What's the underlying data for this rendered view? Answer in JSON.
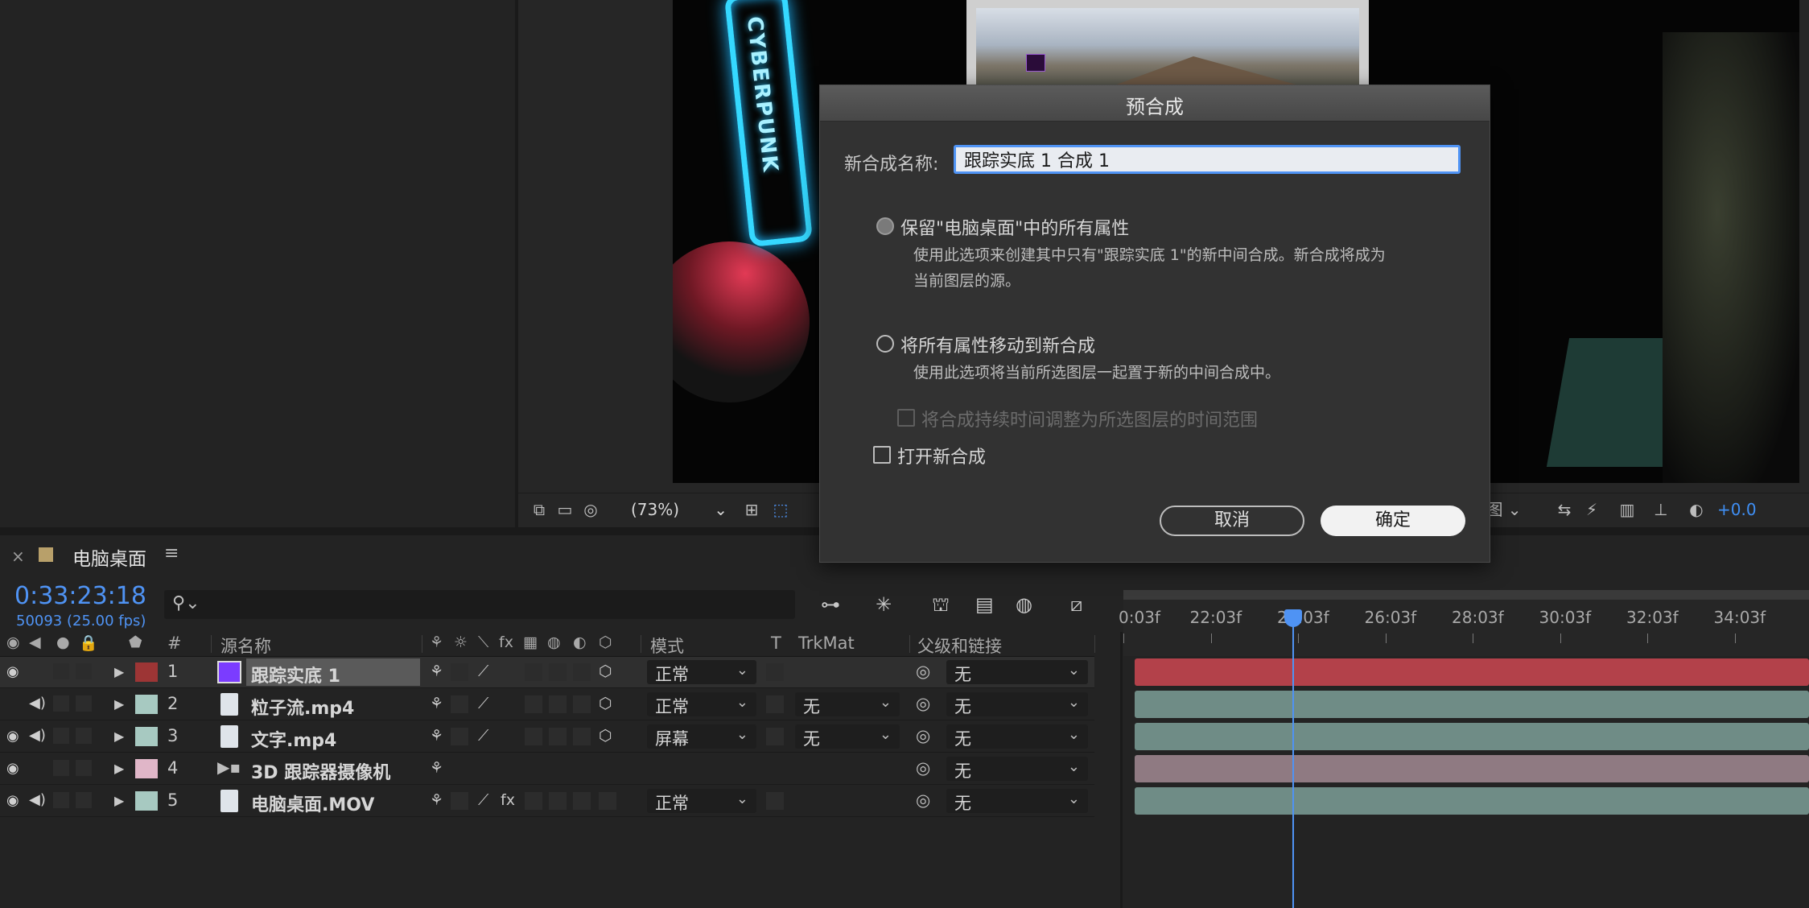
{
  "viewer": {
    "image_text": "CYBERPUNK",
    "zoom_label": "(73%)",
    "view_dropdown_label": "图",
    "exposure_value": "+0.0"
  },
  "timeline": {
    "tab_title": "电脑桌面",
    "timecode": "0:33:23:18",
    "frame_info": "50093 (25.00 fps)",
    "search_placeholder": "",
    "columns": {
      "number": "#",
      "source_name": "源名称",
      "mode": "模式",
      "t": "T",
      "trkmat": "TrkMat",
      "parent": "父级和链接"
    },
    "ruler_ticks": [
      "0:03f",
      "22:03f",
      "24:03f",
      "26:03f",
      "28:03f",
      "30:03f",
      "32:03f",
      "34:03f"
    ],
    "layers": [
      {
        "num": "1",
        "name": "跟踪实底 1",
        "label_color": "#9d3535",
        "mode": "正常",
        "trkmat": "",
        "parent": "无",
        "clip_color": "#b3414a"
      },
      {
        "num": "2",
        "name": "粒子流.mp4",
        "label_color": "#a7c9c1",
        "mode": "正常",
        "trkmat": "无",
        "parent": "无",
        "clip_color": "#6f8c86"
      },
      {
        "num": "3",
        "name": "文字.mp4",
        "label_color": "#a7c9c1",
        "mode": "屏幕",
        "trkmat": "无",
        "parent": "无",
        "clip_color": "#6f8c86"
      },
      {
        "num": "4",
        "name": "3D 跟踪器摄像机",
        "label_color": "#e0b6c8",
        "mode": "",
        "trkmat": "",
        "parent": "无",
        "clip_color": "#8f7a82"
      },
      {
        "num": "5",
        "name": "电脑桌面.MOV",
        "label_color": "#a7c9c1",
        "mode": "正常",
        "trkmat": "",
        "parent": "无",
        "clip_color": "#6f8c86"
      }
    ]
  },
  "dialog": {
    "title": "预合成",
    "name_label": "新合成名称:",
    "name_value": "跟踪实底 1 合成 1",
    "option1_label": "保留\"电脑桌面\"中的所有属性",
    "option1_desc_line1": "使用此选项来创建其中只有\"跟踪实底 1\"的新中间合成。新合成将成为",
    "option1_desc_line2": "当前图层的源。",
    "option2_label": "将所有属性移动到新合成",
    "option2_desc": "使用此选项将当前所选图层一起置于新的中间合成中。",
    "adjust_duration_label": "将合成持续时间调整为所选图层的时间范围",
    "open_new_label": "打开新合成",
    "cancel_label": "取消",
    "ok_label": "确定"
  }
}
